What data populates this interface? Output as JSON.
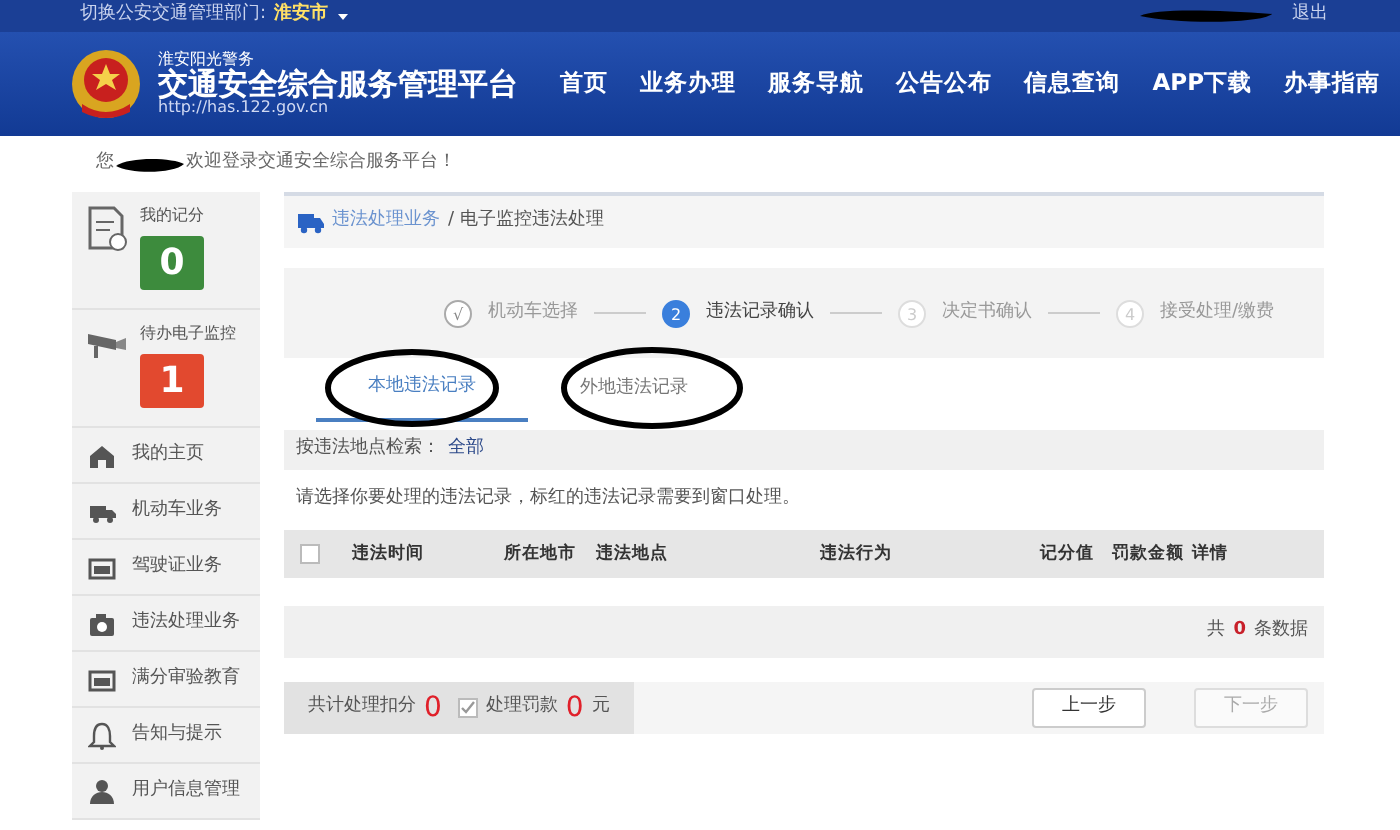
{
  "top_bar": {
    "switch_label": "切换公安交通管理部门:",
    "city": "淮安市",
    "logout": "退出"
  },
  "header": {
    "subtitle": "淮安阳光警务",
    "title": "交通安全综合服务管理平台",
    "url": "http://has.122.gov.cn",
    "nav": [
      {
        "label": "首页"
      },
      {
        "label": "业务办理"
      },
      {
        "label": "服务导航"
      },
      {
        "label": "公告公布"
      },
      {
        "label": "信息查询"
      },
      {
        "label": "APP下载"
      },
      {
        "label": "办事指南"
      }
    ]
  },
  "welcome": {
    "prefix": "您",
    "text": "欢迎登录交通安全综合服务平台！"
  },
  "sidebar": {
    "cards": [
      {
        "label": "我的记分",
        "value": "0",
        "color": "#3d8b3d"
      },
      {
        "label": "待办电子监控",
        "value": "1",
        "color": "#e2492f"
      }
    ],
    "items": [
      {
        "label": "我的主页"
      },
      {
        "label": "机动车业务"
      },
      {
        "label": "驾驶证业务"
      },
      {
        "label": "违法处理业务"
      },
      {
        "label": "满分审验教育"
      },
      {
        "label": "告知与提示"
      },
      {
        "label": "用户信息管理"
      }
    ]
  },
  "breadcrumb": {
    "section": "违法处理业务",
    "current": "/ 电子监控违法处理"
  },
  "steps": [
    {
      "mark": "√",
      "label": "机动车选择",
      "done": true,
      "selected": false
    },
    {
      "mark": "2",
      "label": "违法记录确认",
      "done": false,
      "selected": true
    },
    {
      "mark": "3",
      "label": "决定书确认",
      "done": false,
      "selected": false
    },
    {
      "mark": "4",
      "label": "接受处理/缴费",
      "done": false,
      "selected": false
    }
  ],
  "tabs": [
    {
      "label": "本地违法记录",
      "selected": true
    },
    {
      "label": "外地违法记录",
      "selected": false
    }
  ],
  "filter": {
    "label": "按违法地点检索：",
    "value": "全部"
  },
  "notice": "请选择你要处理的违法记录，标红的违法记录需要到窗口处理。",
  "table": {
    "select_all": false,
    "columns": [
      "违法时间",
      "所在地市",
      "违法地点",
      "违法行为",
      "记分值",
      "罚款金额",
      "详情"
    ],
    "total_prefix": "共",
    "total_count": "0",
    "total_suffix": "条数据"
  },
  "summary": {
    "points_label": "共计处理扣分",
    "points": "0",
    "fine_checked": true,
    "fine_label": "处理罚款",
    "fine": "0",
    "unit": "元"
  },
  "buttons": [
    {
      "label": "上一步",
      "disabled": false
    },
    {
      "label": "下一步",
      "disabled": true
    }
  ]
}
